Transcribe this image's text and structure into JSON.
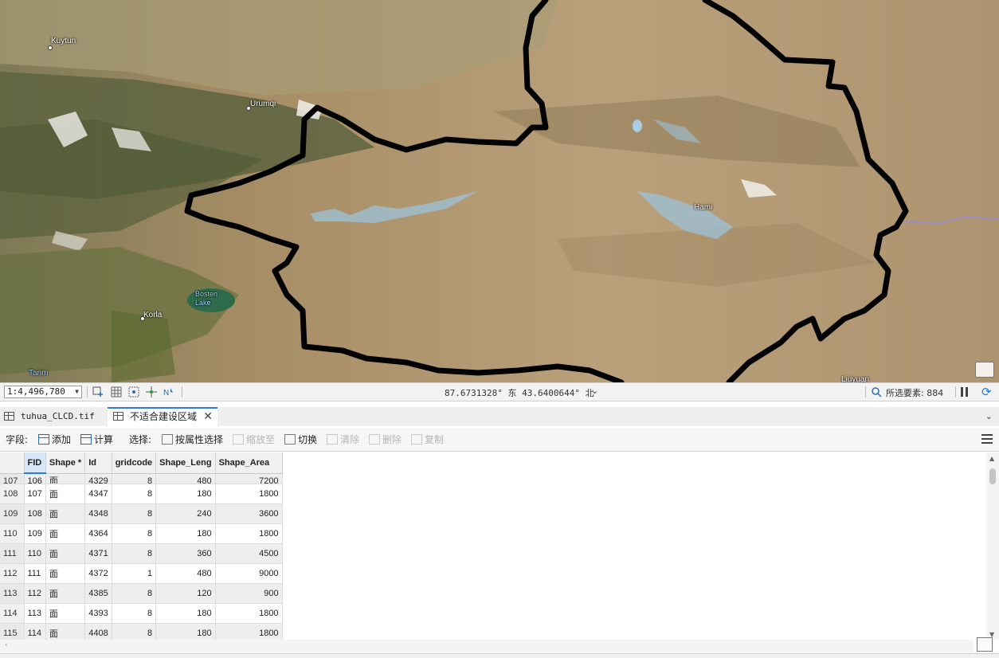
{
  "map": {
    "places": [
      {
        "name": "Kuytun"
      },
      {
        "name": "Urumqi"
      },
      {
        "name": "Hami"
      },
      {
        "name": "Bosten Lake"
      },
      {
        "name": "Korla"
      },
      {
        "name": "Tarim"
      },
      {
        "name": "Liuyuan"
      }
    ]
  },
  "statusbar": {
    "scale": "1:4,496,780",
    "coordinates": "87.6731328° 东 43.6400644° 北",
    "selected_features": "所选要素: 884"
  },
  "tabs": [
    {
      "label": "tuhua_CLCD.tif"
    },
    {
      "label": "不适合建设区域"
    }
  ],
  "toolbar": {
    "field_label": "字段:",
    "add": "添加",
    "calculate": "计算",
    "selection_label": "选择:",
    "select_by_attributes": "按属性选择",
    "zoom_to": "缩放至",
    "switch": "切换",
    "clear": "清除",
    "delete": "删除",
    "copy": "复制"
  },
  "table": {
    "columns": [
      "FID",
      "Shape *",
      "Id",
      "gridcode",
      "Shape_Leng",
      "Shape_Area"
    ],
    "partial_row": {
      "row": "107",
      "fid": "106",
      "shape": "面",
      "id": "4329",
      "gridcode": "8",
      "leng": "480",
      "area": "7200"
    },
    "rows": [
      {
        "row": "108",
        "fid": "107",
        "shape": "面",
        "id": "4347",
        "gridcode": "8",
        "leng": "180",
        "area": "1800"
      },
      {
        "row": "109",
        "fid": "108",
        "shape": "面",
        "id": "4348",
        "gridcode": "8",
        "leng": "240",
        "area": "3600"
      },
      {
        "row": "110",
        "fid": "109",
        "shape": "面",
        "id": "4364",
        "gridcode": "8",
        "leng": "180",
        "area": "1800"
      },
      {
        "row": "111",
        "fid": "110",
        "shape": "面",
        "id": "4371",
        "gridcode": "8",
        "leng": "360",
        "area": "4500"
      },
      {
        "row": "112",
        "fid": "111",
        "shape": "面",
        "id": "4372",
        "gridcode": "1",
        "leng": "480",
        "area": "9000"
      },
      {
        "row": "113",
        "fid": "112",
        "shape": "面",
        "id": "4385",
        "gridcode": "8",
        "leng": "120",
        "area": "900"
      },
      {
        "row": "114",
        "fid": "113",
        "shape": "面",
        "id": "4393",
        "gridcode": "8",
        "leng": "180",
        "area": "1800"
      },
      {
        "row": "115",
        "fid": "114",
        "shape": "面",
        "id": "4408",
        "gridcode": "8",
        "leng": "180",
        "area": "1800"
      }
    ]
  },
  "colors": {
    "accent": "#2b7bd3",
    "boundary": "#000000",
    "terrain": "#b49a73",
    "mountain_green": "#5f6e3c"
  }
}
